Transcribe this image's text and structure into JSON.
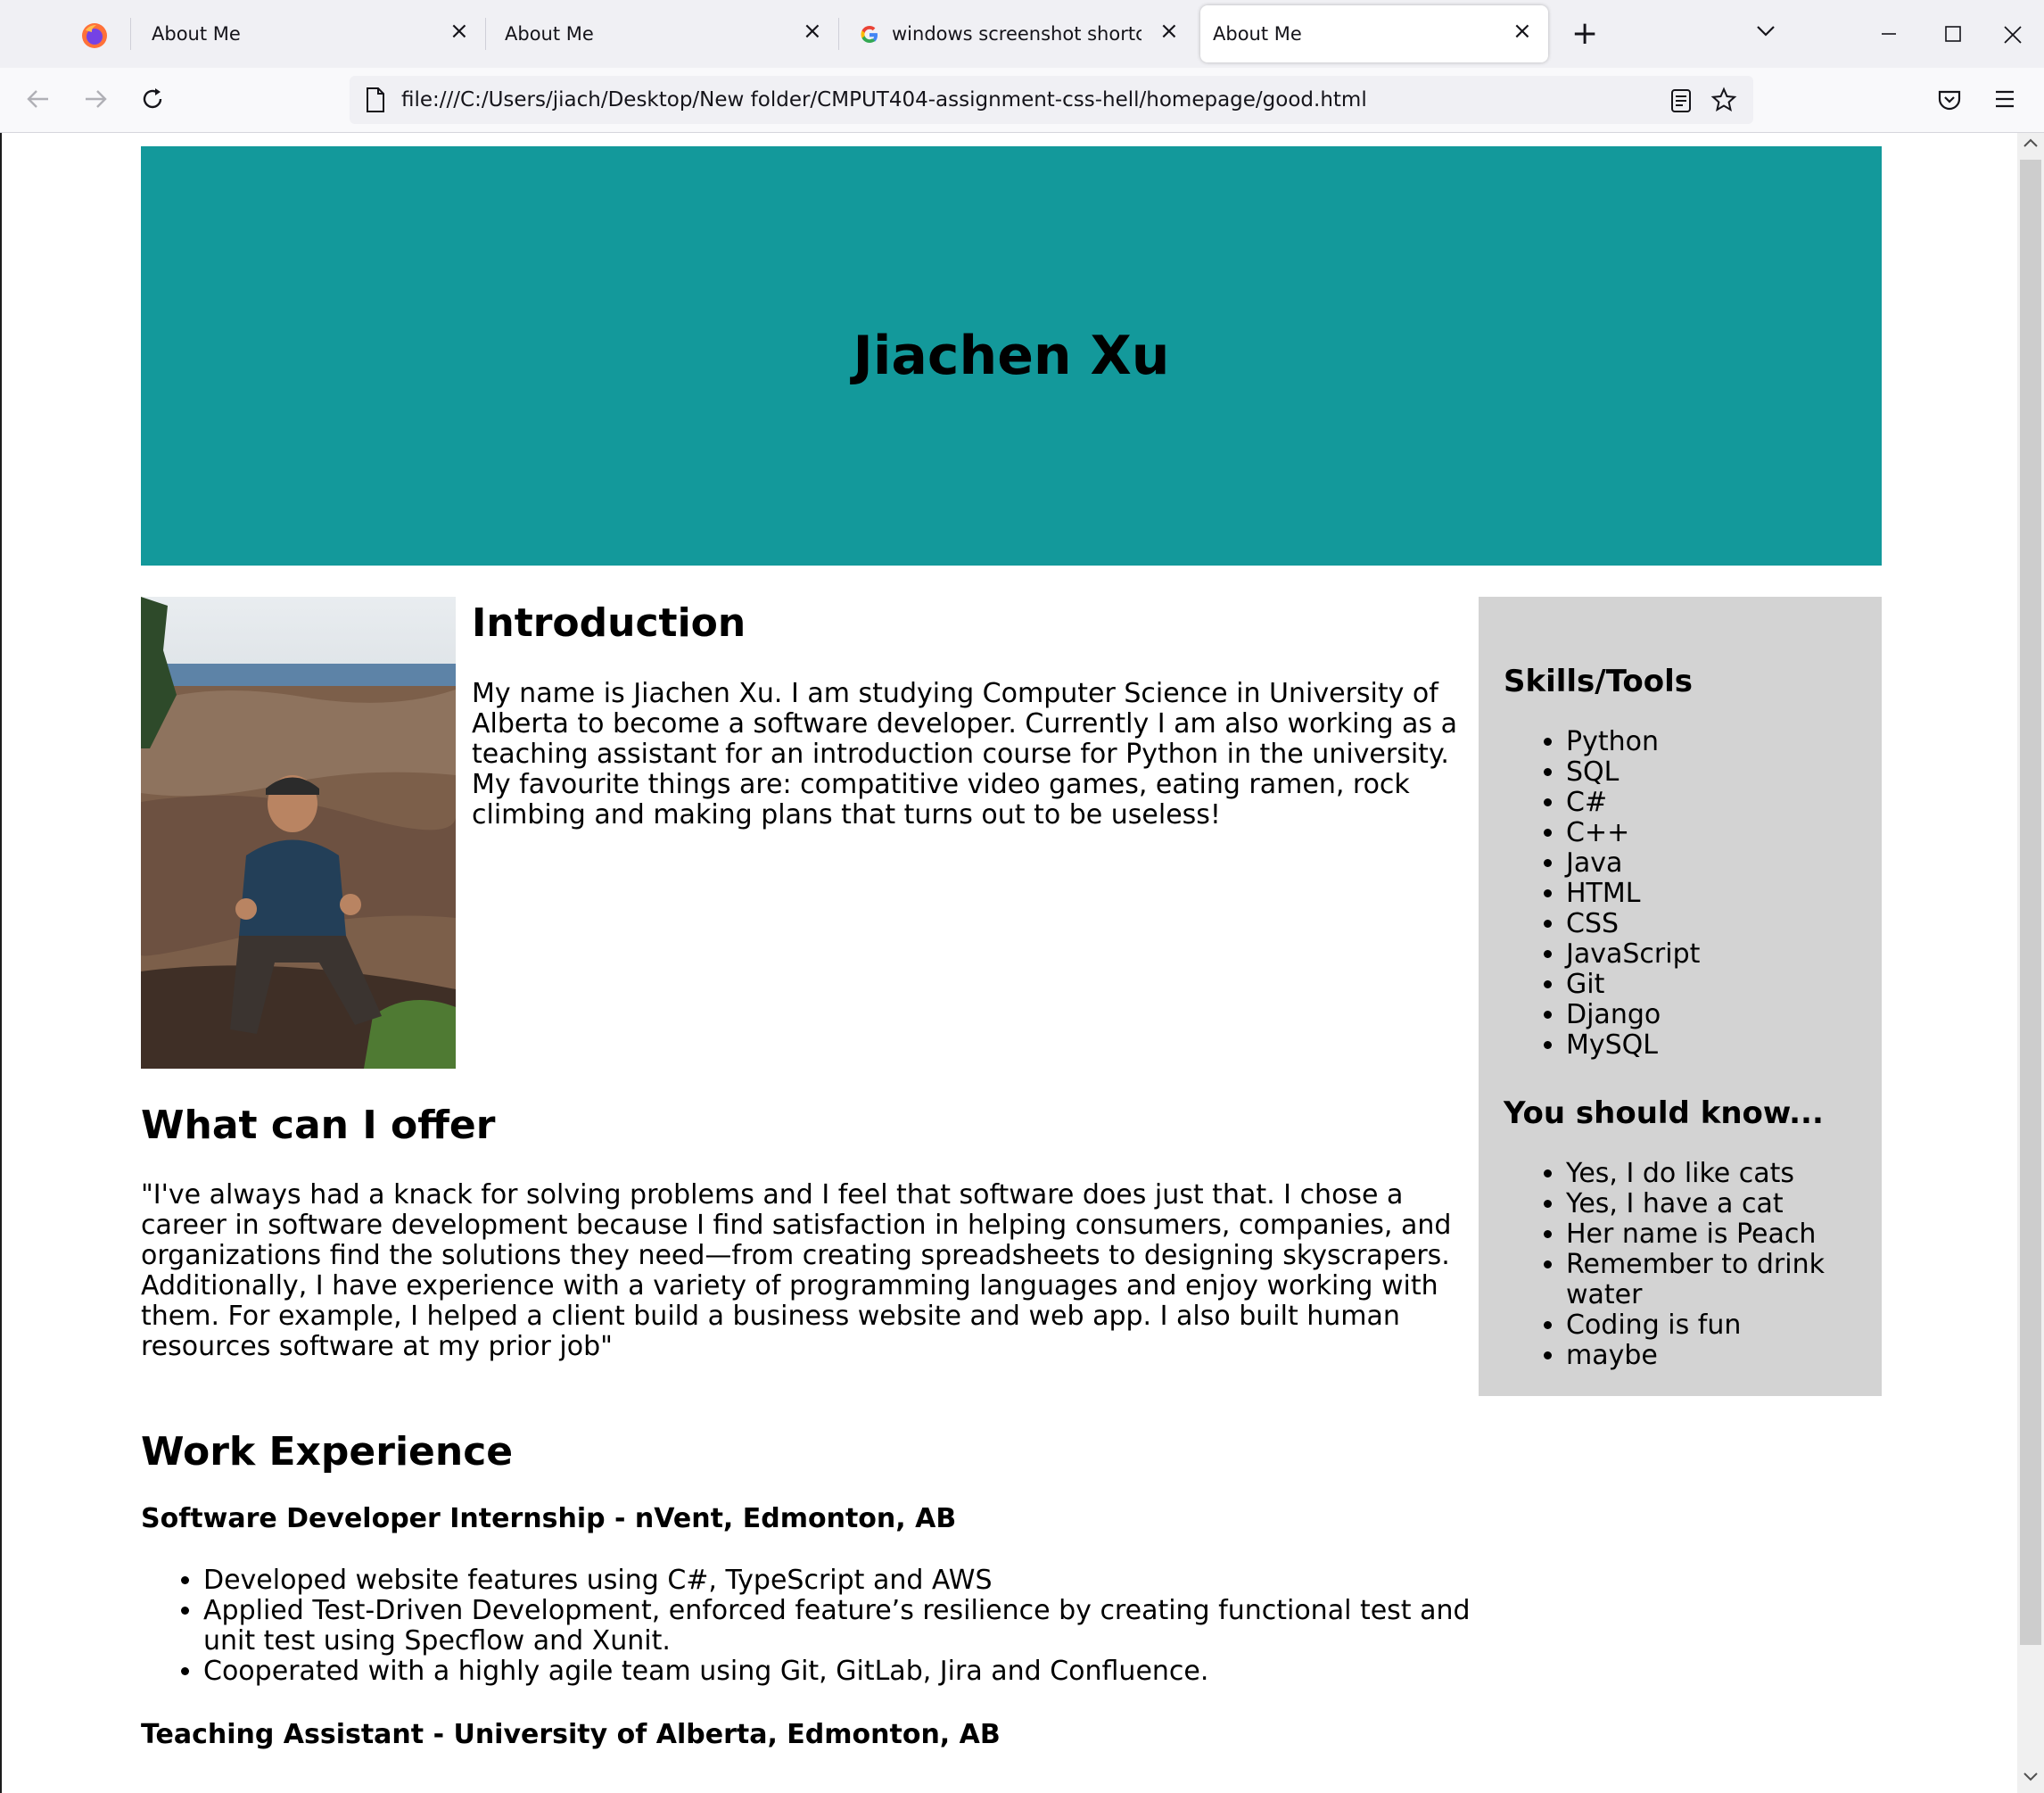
{
  "browser": {
    "tabs": [
      {
        "label": "About Me",
        "close": "×"
      },
      {
        "label": "About Me",
        "close": "×"
      },
      {
        "label": "windows screenshot shortcut - (",
        "close": "×"
      },
      {
        "label": "About Me",
        "close": "×"
      }
    ],
    "new_tab": "+",
    "url": "file:///C:/Users/jiach/Desktop/New folder/CMPUT404-assignment-css-hell/homepage/good.html",
    "icons": [
      "firefox-icon",
      "google-icon",
      "back-icon",
      "forward-icon",
      "reload-icon",
      "page-icon",
      "reader-view-icon",
      "bookmark-star-icon",
      "pocket-icon",
      "menu-icon",
      "minimize-icon",
      "maximize-icon",
      "close-icon"
    ],
    "colors": {
      "tabbar": "#f0f0f4",
      "navbar": "#f9f9fb"
    }
  },
  "page": {
    "title": "Jiachen Xu",
    "banner_color": "#13999b",
    "sidebar_color": "#d3d3d3",
    "intro": {
      "heading": "Introduction",
      "text": "My name is Jiachen Xu. I am studying Computer Science in University of Alberta to become a software developer. Currently I am also working as a teaching assistant for an introduction course for Python in the university. My favourite things are: compatitive video games, eating ramen, rock climbing and making plans that turns out to be useless!"
    },
    "offer": {
      "heading": "What can I offer",
      "text": "\"I've always had a knack for solving problems and I feel that software does just that. I chose a career in software development because I find satisfaction in helping consumers, companies, and organizations find the solutions they need—from creating spreadsheets to designing skyscrapers. Additionally, I have experience with a variety of programming languages and enjoy working with them. For example, I helped a client build a business website and web app. I also built human resources software at my prior job\""
    },
    "work": {
      "heading": "Work Experience",
      "jobs": [
        {
          "title": "Software Developer Internship - nVent, Edmonton, AB",
          "bullets": [
            "Developed website features using C#, TypeScript and AWS",
            "Applied Test-Driven Development, enforced feature’s resilience by creating functional test and unit test using Specflow and Xunit.",
            "Cooperated with a highly agile team using Git, GitLab, Jira and Confluence."
          ]
        },
        {
          "title": "Teaching Assistant - University of Alberta, Edmonton, AB"
        }
      ]
    },
    "sidebar": {
      "skills_heading": "Skills/Tools",
      "skills": [
        "Python",
        "SQL",
        "C#",
        "C++",
        "Java",
        "HTML",
        "CSS",
        "JavaScript",
        "Git",
        "Django",
        "MySQL"
      ],
      "know_heading": "You should know...",
      "facts": [
        "Yes, I do like cats",
        "Yes, I have a cat",
        "Her name is Peach",
        "Remember to drink water",
        "Coding is fun",
        "maybe"
      ]
    }
  }
}
